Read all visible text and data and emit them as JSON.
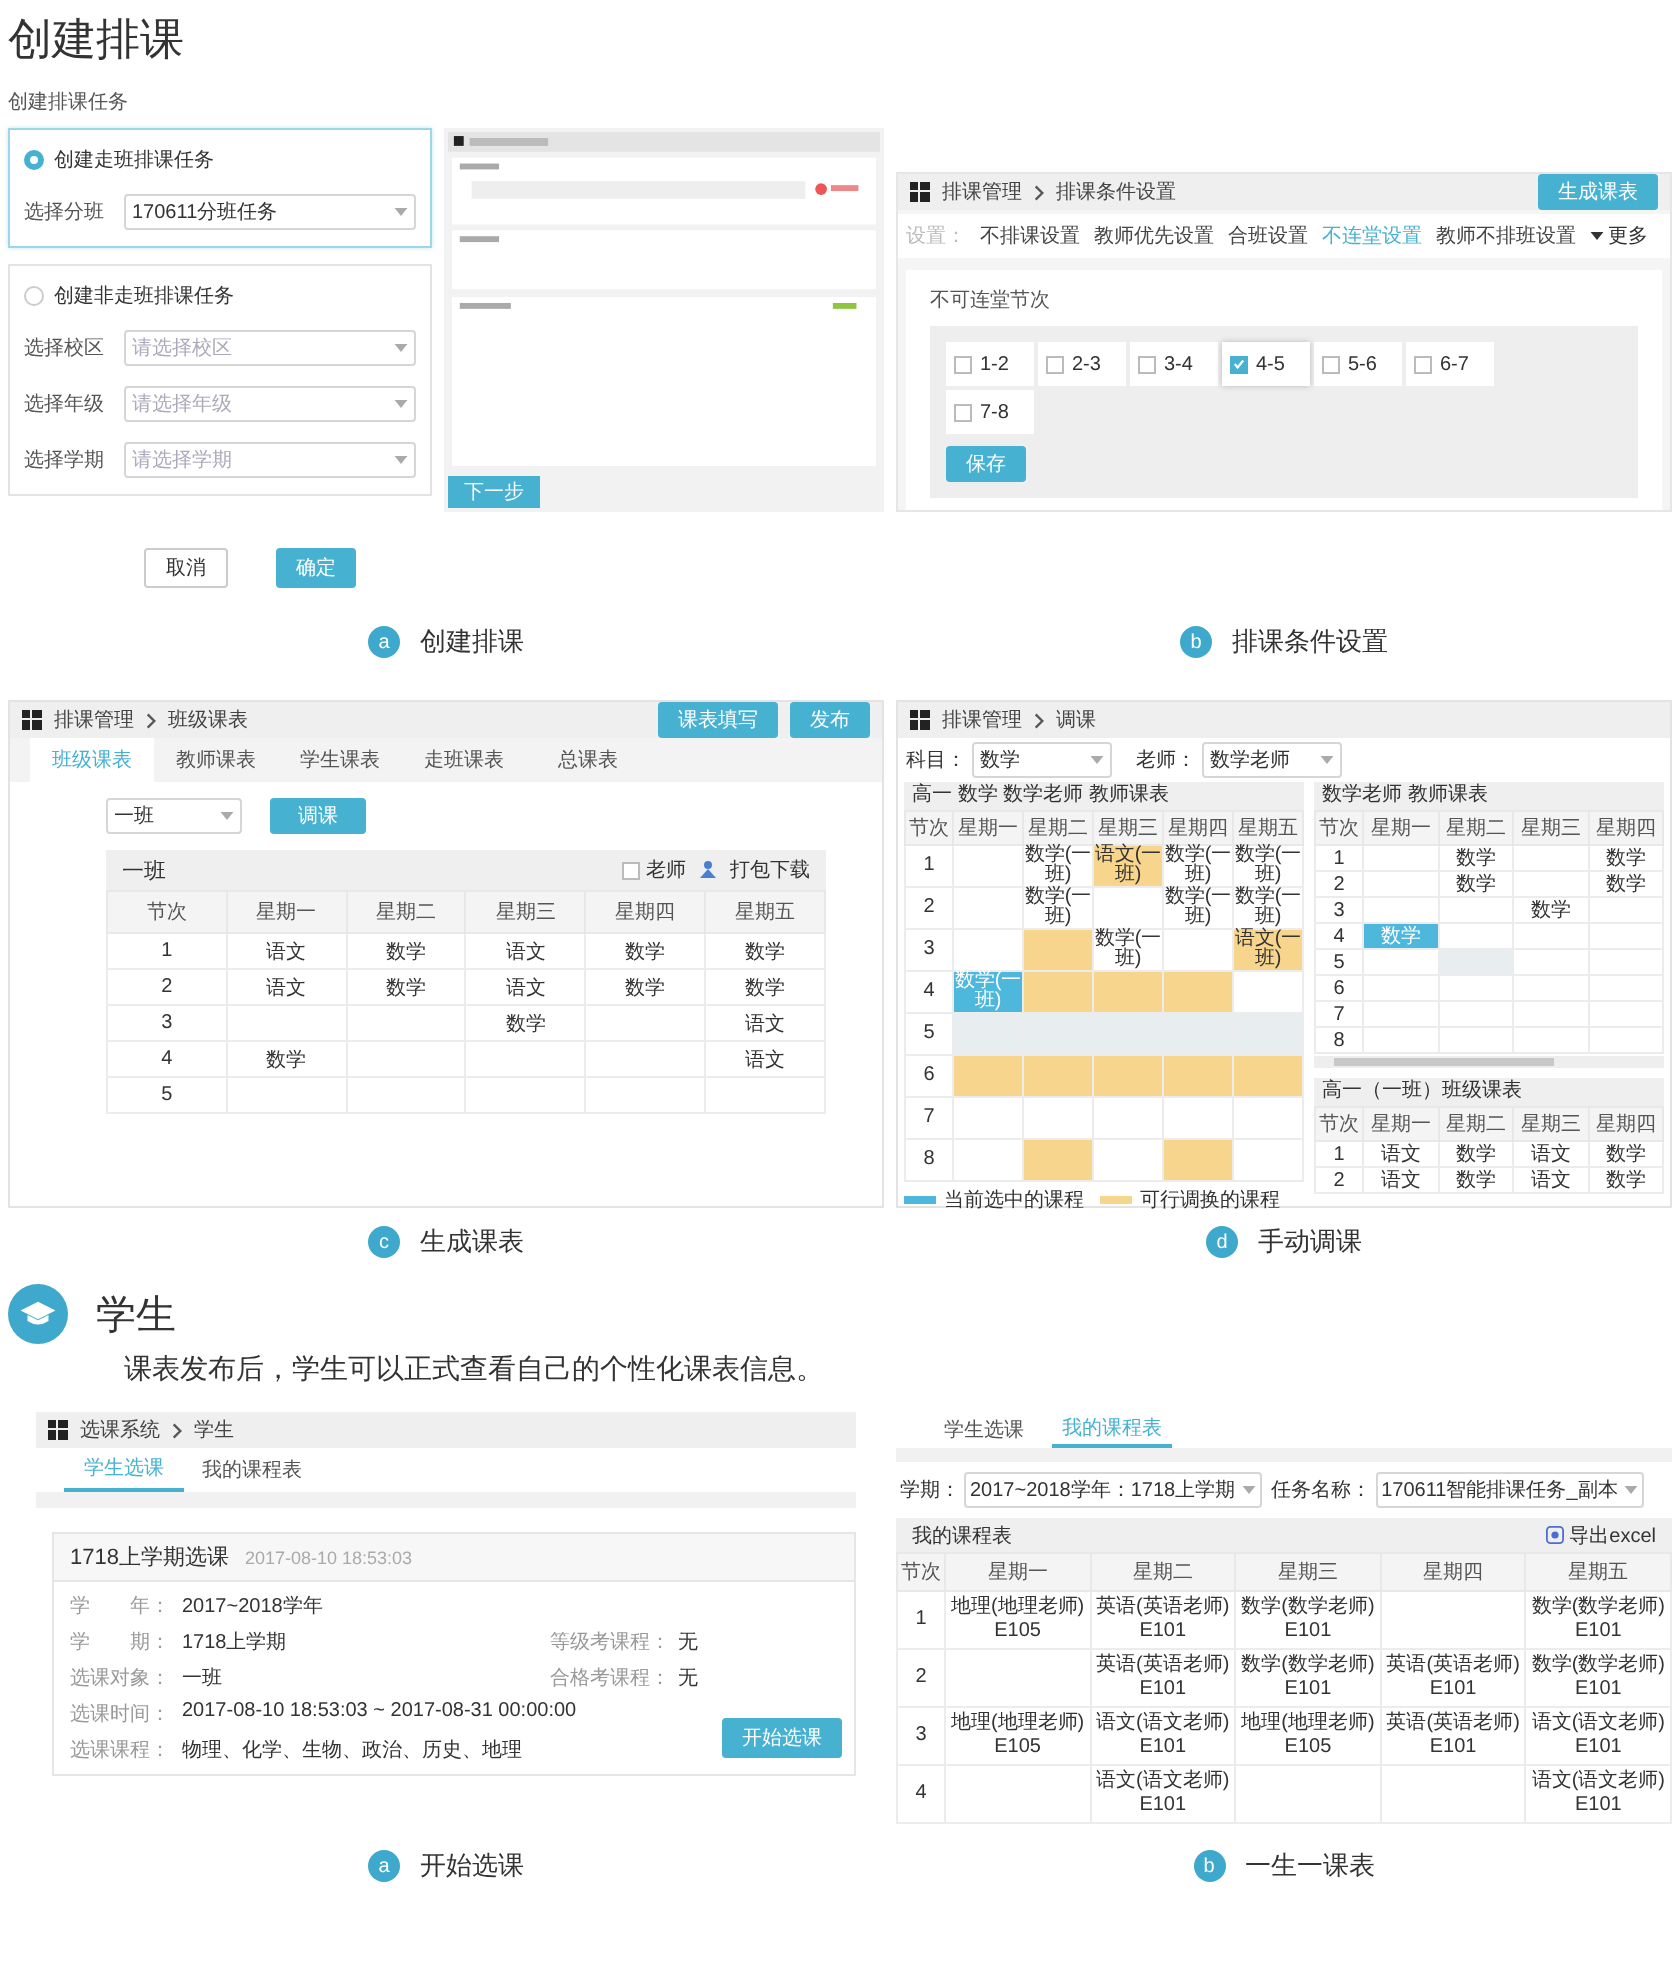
{
  "title": "创建排课",
  "panels": [
    {
      "kind": "create_task",
      "heading": "创建排课任务",
      "options": [
        {
          "label": "创建走班排课任务",
          "selected": true,
          "fields": [
            {
              "label": "选择分班",
              "value": "170611分班任务"
            }
          ]
        },
        {
          "label": "创建非走班排课任务",
          "selected": false,
          "fields": [
            {
              "label": "选择校区",
              "placeholder": "请选择校区"
            },
            {
              "label": "选择年级",
              "placeholder": "请选择年级"
            },
            {
              "label": "选择学期",
              "placeholder": "请选择学期"
            }
          ]
        }
      ],
      "preview": {
        "next_button": "下一步"
      },
      "buttons": [
        {
          "label": "取消",
          "kind": "cancel"
        },
        {
          "label": "确定",
          "kind": "confirm"
        }
      ],
      "caption": {
        "letter": "a",
        "text": "创建排课"
      }
    },
    {
      "kind": "conditions",
      "breadcrumb": [
        "排课管理",
        "排课条件设置"
      ],
      "action": "生成课表",
      "tabs_prefix": "设置：",
      "tabs": [
        {
          "label": "不排课设置",
          "selected": false
        },
        {
          "label": "教师优先设置",
          "selected": false
        },
        {
          "label": "合班设置",
          "selected": false
        },
        {
          "label": "不连堂设置",
          "selected": true
        },
        {
          "label": "教师不排班设置",
          "selected": false
        }
      ],
      "more": "更多",
      "section_title": "不可连堂节次",
      "periods": [
        {
          "label": "1-2",
          "checked": false
        },
        {
          "label": "2-3",
          "checked": false
        },
        {
          "label": "3-4",
          "checked": false
        },
        {
          "label": "4-5",
          "checked": true
        },
        {
          "label": "5-6",
          "checked": false
        },
        {
          "label": "6-7",
          "checked": false
        },
        {
          "label": "7-8",
          "checked": false
        }
      ],
      "save_button": "保存",
      "caption": {
        "letter": "b",
        "text": "排课条件设置"
      }
    },
    {
      "kind": "class_timetable",
      "breadcrumb": [
        "排课管理",
        "班级课表"
      ],
      "actions": [
        "课表填写",
        "发布"
      ],
      "tabs": [
        {
          "label": "班级课表",
          "selected": true
        },
        {
          "label": "教师课表",
          "selected": false
        },
        {
          "label": "学生课表",
          "selected": false
        },
        {
          "label": "走班课表",
          "selected": false
        },
        {
          "label": "总课表",
          "selected": false
        }
      ],
      "class_select": "一班",
      "adjust_button": "调课",
      "table": {
        "title": "一班",
        "teacher_checkbox": {
          "label": "老师",
          "checked": false
        },
        "download": "打包下载",
        "columns": [
          "节次",
          "星期一",
          "星期二",
          "星期三",
          "星期四",
          "星期五"
        ],
        "rows": [
          [
            "1",
            "语文",
            "数学",
            "语文",
            "数学",
            "数学"
          ],
          [
            "2",
            "语文",
            "数学",
            "语文",
            "数学",
            "数学"
          ],
          [
            "3",
            "",
            "",
            "数学",
            "",
            "语文"
          ],
          [
            "4",
            "数学",
            "",
            "",
            "",
            "语文"
          ],
          [
            "5",
            "",
            "",
            "",
            "",
            ""
          ]
        ]
      },
      "caption": {
        "letter": "c",
        "text": "生成课表"
      }
    },
    {
      "kind": "manual_adjust",
      "breadcrumb": [
        "排课管理",
        "调课"
      ],
      "filters": [
        {
          "label": "科目：",
          "value": "数学"
        },
        {
          "label": "老师：",
          "value": "数学老师"
        }
      ],
      "main_table": {
        "title": "高一 数学 数学老师 教师课表",
        "columns": [
          "节次",
          "星期一",
          "星期二",
          "星期三",
          "星期四",
          "星期五"
        ],
        "rows": [
          {
            "cells": [
              {
                "text": "1",
                "kind": "period"
              },
              {
                "kind": "plain"
              },
              {
                "text": "数学(一班)",
                "kind": "plain"
              },
              {
                "text": "语文(一班)",
                "kind": "available"
              },
              {
                "text": "数学(一班)",
                "kind": "plain"
              },
              {
                "text": "数学(一班)",
                "kind": "plain"
              }
            ]
          },
          {
            "cells": [
              {
                "text": "2",
                "kind": "period"
              },
              {
                "kind": "plain"
              },
              {
                "text": "数学(一班)",
                "kind": "plain"
              },
              {
                "kind": "plain"
              },
              {
                "text": "数学(一班)",
                "kind": "plain"
              },
              {
                "text": "数学(一班)",
                "kind": "plain"
              }
            ]
          },
          {
            "cells": [
              {
                "text": "3",
                "kind": "period"
              },
              {
                "kind": "plain"
              },
              {
                "kind": "available"
              },
              {
                "text": "数学(一班)",
                "kind": "plain"
              },
              {
                "kind": "plain"
              },
              {
                "text": "语文(一班)",
                "kind": "available"
              }
            ]
          },
          {
            "cells": [
              {
                "text": "4",
                "kind": "period"
              },
              {
                "text": "数学(一班)",
                "kind": "current"
              },
              {
                "kind": "available"
              },
              {
                "kind": "available"
              },
              {
                "kind": "available"
              },
              {
                "kind": "plain"
              }
            ]
          },
          {
            "cells": [
              {
                "text": "5",
                "kind": "period"
              },
              {
                "kind": "disabled"
              },
              {
                "kind": "disabled"
              },
              {
                "kind": "disabled"
              },
              {
                "kind": "disabled"
              },
              {
                "kind": "disabled"
              }
            ]
          },
          {
            "cells": [
              {
                "text": "6",
                "kind": "period"
              },
              {
                "kind": "available"
              },
              {
                "kind": "available"
              },
              {
                "kind": "available"
              },
              {
                "kind": "available"
              },
              {
                "kind": "available"
              }
            ]
          },
          {
            "cells": [
              {
                "text": "7",
                "kind": "period"
              },
              {
                "kind": "plain"
              },
              {
                "kind": "plain"
              },
              {
                "kind": "plain"
              },
              {
                "kind": "plain"
              },
              {
                "kind": "plain"
              }
            ]
          },
          {
            "cells": [
              {
                "text": "8",
                "kind": "period"
              },
              {
                "kind": "plain"
              },
              {
                "kind": "available"
              },
              {
                "kind": "plain"
              },
              {
                "kind": "available"
              },
              {
                "kind": "plain"
              }
            ]
          }
        ]
      },
      "legend": [
        {
          "label": "当前选中的课程",
          "kind": "current"
        },
        {
          "label": "可行调换的课程",
          "kind": "available"
        }
      ],
      "side_tables": [
        {
          "title": "数学老师 教师课表",
          "columns": [
            "节次",
            "星期一",
            "星期二",
            "星期三",
            "星期四"
          ],
          "rows": [
            {
              "cells": [
                {
                  "text": "1",
                  "kind": "period"
                },
                {
                  "kind": "plain"
                },
                {
                  "text": "数学",
                  "kind": "plain"
                },
                {
                  "kind": "plain"
                },
                {
                  "text": "数学",
                  "kind": "plain"
                }
              ]
            },
            {
              "cells": [
                {
                  "text": "2",
                  "kind": "period"
                },
                {
                  "kind": "plain"
                },
                {
                  "text": "数学",
                  "kind": "plain"
                },
                {
                  "kind": "plain"
                },
                {
                  "text": "数学",
                  "kind": "plain"
                }
              ]
            },
            {
              "cells": [
                {
                  "text": "3",
                  "kind": "period"
                },
                {
                  "kind": "plain"
                },
                {
                  "kind": "plain"
                },
                {
                  "text": "数学",
                  "kind": "plain"
                },
                {
                  "kind": "plain"
                }
              ]
            },
            {
              "cells": [
                {
                  "text": "4",
                  "kind": "period"
                },
                {
                  "text": "数学",
                  "kind": "current"
                },
                {
                  "kind": "plain"
                },
                {
                  "kind": "plain"
                },
                {
                  "kind": "plain"
                }
              ]
            },
            {
              "cells": [
                {
                  "text": "5",
                  "kind": "period"
                },
                {
                  "kind": "plain"
                },
                {
                  "kind": "disabled"
                },
                {
                  "kind": "plain"
                },
                {
                  "kind": "plain"
                }
              ]
            },
            {
              "cells": [
                {
                  "text": "6",
                  "kind": "period"
                },
                {
                  "kind": "plain"
                },
                {
                  "kind": "plain"
                },
                {
                  "kind": "plain"
                },
                {
                  "kind": "plain"
                }
              ]
            },
            {
              "cells": [
                {
                  "text": "7",
                  "kind": "period"
                },
                {
                  "kind": "plain"
                },
                {
                  "kind": "plain"
                },
                {
                  "kind": "plain"
                },
                {
                  "kind": "plain"
                }
              ]
            },
            {
              "cells": [
                {
                  "text": "8",
                  "kind": "period"
                },
                {
                  "kind": "plain"
                },
                {
                  "kind": "plain"
                },
                {
                  "kind": "plain"
                },
                {
                  "kind": "plain"
                }
              ]
            }
          ]
        },
        {
          "title": "高一（一班）班级课表",
          "columns": [
            "节次",
            "星期一",
            "星期二",
            "星期三",
            "星期四"
          ],
          "rows": [
            {
              "cells": [
                {
                  "text": "1",
                  "kind": "period"
                },
                {
                  "text": "语文",
                  "kind": "plain"
                },
                {
                  "text": "数学",
                  "kind": "plain"
                },
                {
                  "text": "语文",
                  "kind": "plain"
                },
                {
                  "text": "数学",
                  "kind": "plain"
                }
              ]
            },
            {
              "cells": [
                {
                  "text": "2",
                  "kind": "period"
                },
                {
                  "text": "语文",
                  "kind": "plain"
                },
                {
                  "text": "数学",
                  "kind": "plain"
                },
                {
                  "text": "语文",
                  "kind": "plain"
                },
                {
                  "text": "数学",
                  "kind": "plain"
                }
              ]
            }
          ]
        }
      ],
      "caption": {
        "letter": "d",
        "text": "手动调课"
      }
    }
  ],
  "student_section": {
    "title": "学生",
    "description": "课表发布后，学生可以正式查看自己的个性化课表信息。"
  },
  "student_panels": [
    {
      "kind": "course_selection",
      "breadcrumb": [
        "选课系统",
        "学生"
      ],
      "tabs": [
        {
          "label": "学生选课",
          "selected": true
        },
        {
          "label": "我的课程表",
          "selected": false
        }
      ],
      "card": {
        "title": "1718上学期选课",
        "time": "2017-08-10 18:53:03",
        "rows": [
          [
            {
              "label": "学　　年：",
              "value": "2017~2018学年"
            }
          ],
          [
            {
              "label": "学　　期：",
              "value": "1718上学期"
            },
            {
              "label": "等级考课程：",
              "value": "无"
            }
          ],
          [
            {
              "label": "选课对象：",
              "value": "一班"
            },
            {
              "label": "合格考课程：",
              "value": "无"
            }
          ],
          [
            {
              "label": "选课时间：",
              "value": "2017-08-10 18:53:03 ~ 2017-08-31 00:00:00"
            }
          ],
          [
            {
              "label": "选课课程：",
              "value": "物理、化学、生物、政治、历史、地理"
            }
          ]
        ],
        "button": "开始选课"
      },
      "caption": {
        "letter": "a",
        "text": "开始选课"
      }
    },
    {
      "kind": "my_timetable",
      "tabs": [
        {
          "label": "学生选课",
          "selected": false
        },
        {
          "label": "我的课程表",
          "selected": true
        }
      ],
      "filters": [
        {
          "label": "学期：",
          "value": "2017~2018学年：1718上学期"
        },
        {
          "label": "任务名称：",
          "value": "170611智能排课任务_副本"
        }
      ],
      "table": {
        "title": "我的课程表",
        "export": "导出excel",
        "columns": [
          "节次",
          "星期一",
          "星期二",
          "星期三",
          "星期四",
          "星期五"
        ],
        "rows": [
          [
            {
              "lines": [
                "1"
              ]
            },
            {
              "lines": [
                "地理(地理老师)",
                "E105"
              ]
            },
            {
              "lines": [
                "英语(英语老师)",
                "E101"
              ]
            },
            {
              "lines": [
                "数学(数学老师)",
                "E101"
              ]
            },
            {},
            {
              "lines": [
                "数学(数学老师)",
                "E101"
              ]
            }
          ],
          [
            {
              "lines": [
                "2"
              ]
            },
            {},
            {
              "lines": [
                "英语(英语老师)",
                "E101"
              ]
            },
            {
              "lines": [
                "数学(数学老师)",
                "E101"
              ]
            },
            {
              "lines": [
                "英语(英语老师)",
                "E101"
              ]
            },
            {
              "lines": [
                "数学(数学老师)",
                "E101"
              ]
            }
          ],
          [
            {
              "lines": [
                "3"
              ]
            },
            {
              "lines": [
                "地理(地理老师)",
                "E105"
              ]
            },
            {
              "lines": [
                "语文(语文老师)",
                "E101"
              ]
            },
            {
              "lines": [
                "地理(地理老师)",
                "E105"
              ]
            },
            {
              "lines": [
                "英语(英语老师)",
                "E101"
              ]
            },
            {
              "lines": [
                "语文(语文老师)",
                "E101"
              ]
            }
          ],
          [
            {
              "lines": [
                "4"
              ]
            },
            {},
            {
              "lines": [
                "语文(语文老师)",
                "E101"
              ]
            },
            {},
            {},
            {
              "lines": [
                "语文(语文老师)",
                "E101"
              ]
            }
          ]
        ]
      },
      "caption": {
        "letter": "b",
        "text": "一生一课表"
      }
    }
  ]
}
